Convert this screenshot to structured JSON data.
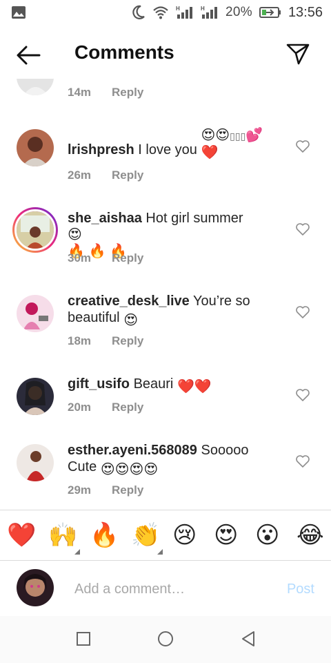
{
  "status_bar": {
    "battery_percent": "20%",
    "time": "13:56",
    "icons": [
      "image-icon",
      "moon-icon",
      "wifi-icon",
      "signal-h-icon",
      "signal-h-icon",
      "battery-charging-icon"
    ]
  },
  "header": {
    "title": "Comments",
    "back_icon": "back-arrow-icon",
    "share_icon": "direct-send-icon"
  },
  "comments": [
    {
      "username": "",
      "text": "",
      "time": "14m",
      "reply": "Reply",
      "partial": true
    },
    {
      "username": "lrishpresh",
      "text": "I love you",
      "emojis": [
        "😍",
        "😍",
        "▯▯▯",
        "💕",
        "❤️"
      ],
      "time": "26m",
      "reply": "Reply"
    },
    {
      "username": "she_aishaa",
      "text": "Hot girl summer",
      "emojis": [
        "😍",
        "🔥",
        "🔥",
        "🔥"
      ],
      "time": "30m",
      "reply": "Reply",
      "story_ring": true
    },
    {
      "username": "creative_desk_live",
      "text": "You’re so beautiful",
      "emojis": [
        "😍"
      ],
      "time": "18m",
      "reply": "Reply"
    },
    {
      "username": "gift_usifo",
      "text": "Beauri",
      "emojis": [
        "❤️",
        "❤️"
      ],
      "time": "20m",
      "reply": "Reply"
    },
    {
      "username": "esther.ayeni.568089",
      "text": "Sooooo Cute",
      "emojis": [
        "😍",
        "😍",
        "😍",
        "😍"
      ],
      "time": "29m",
      "reply": "Reply"
    }
  ],
  "quick_emojis": [
    "❤️",
    "🙌",
    "🔥",
    "👏",
    "😢",
    "😍",
    "😮",
    "😂"
  ],
  "composer": {
    "placeholder": "Add a comment…",
    "post_label": "Post"
  },
  "nav": [
    "recents-square-icon",
    "home-circle-icon",
    "back-triangle-icon"
  ],
  "colors": {
    "heart_red": "#ed4956",
    "post_disabled": "#b3dbff",
    "meta_gray": "#8e8e8e",
    "text": "#262626"
  }
}
